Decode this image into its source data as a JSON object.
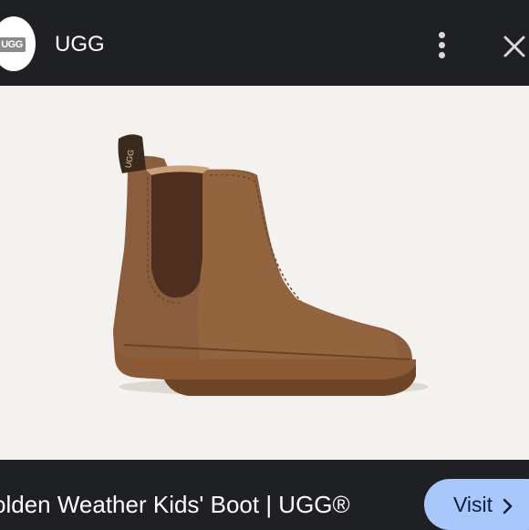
{
  "header": {
    "logo_text": "UGG",
    "site_name": "UGG"
  },
  "product": {
    "image_subject": "brown chelsea boot"
  },
  "caption": {
    "title": "olden Weather Kids' Boot | UGG®"
  },
  "actions": {
    "visit_label": "Visit"
  },
  "colors": {
    "background": "#1f2023",
    "image_background": "#f3f2ef",
    "visit_button": "#a8c7fa",
    "boot_leather": "#8a5e3d"
  },
  "icons": [
    "more-vert-icon",
    "close-icon",
    "chevron-right-icon"
  ]
}
